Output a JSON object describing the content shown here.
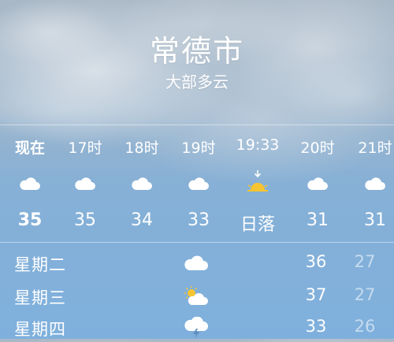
{
  "location": {
    "city": "常德市",
    "condition": "大部多云"
  },
  "hourly": [
    {
      "time": "现在",
      "icon": "cloud-icon",
      "value": "35"
    },
    {
      "time": "17时",
      "icon": "cloud-icon",
      "value": "35"
    },
    {
      "time": "18时",
      "icon": "cloud-icon",
      "value": "34"
    },
    {
      "time": "19时",
      "icon": "cloud-icon",
      "value": "33"
    },
    {
      "time": "19:33",
      "icon": "sunset-icon",
      "value": "日落"
    },
    {
      "time": "20时",
      "icon": "cloud-icon",
      "value": "31"
    },
    {
      "time": "21时",
      "icon": "cloud-icon",
      "value": "31"
    }
  ],
  "daily": [
    {
      "day": "星期二",
      "icon": "cloud-icon",
      "high": "36",
      "low": "27"
    },
    {
      "day": "星期三",
      "icon": "partly-sunny-icon",
      "high": "37",
      "low": "27"
    },
    {
      "day": "星期四",
      "icon": "thunderstorm-icon",
      "high": "33",
      "low": "26"
    }
  ],
  "colors": {
    "sky_top": "#a9b8c6",
    "sky_bottom": "#7fb0dd",
    "sun": "#f7c531",
    "low_temp": "#ffffff8c"
  }
}
